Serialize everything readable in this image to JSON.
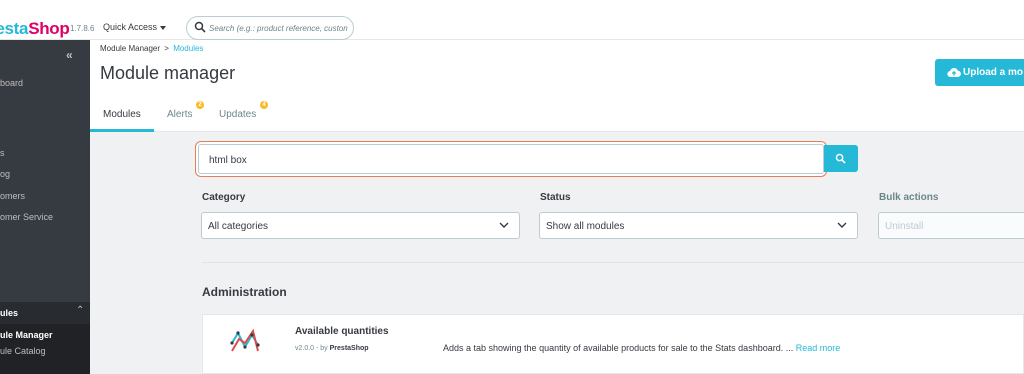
{
  "header": {
    "logo_presta": "Presta",
    "logo_shop": "Shop",
    "version": "1.7.8.6",
    "quick_access": "Quick Access",
    "search_placeholder": "Search (e.g.: product reference, custon"
  },
  "sidebar": {
    "items": [
      {
        "label": "board"
      },
      {
        "label": "s"
      },
      {
        "label": "og"
      },
      {
        "label": "omers"
      },
      {
        "label": "omer Service"
      }
    ],
    "active_section": "ules",
    "sub_items": [
      {
        "label": "ule Manager"
      },
      {
        "label": "ule Catalog"
      }
    ]
  },
  "page": {
    "breadcrumb_parent": "Module Manager",
    "breadcrumb_sep": ">",
    "breadcrumb_current": "Modules",
    "title": "Module manager",
    "upload_label": "Upload a mo"
  },
  "tabs": [
    {
      "label": "Modules",
      "badge": ""
    },
    {
      "label": "Alerts",
      "badge": "2"
    },
    {
      "label": "Updates",
      "badge": "4"
    }
  ],
  "search": {
    "value": "html box"
  },
  "filters": {
    "category_label": "Category",
    "category_value": "All categories",
    "status_label": "Status",
    "status_value": "Show all modules",
    "bulk_label": "Bulk actions",
    "bulk_value": "Uninstall"
  },
  "section": {
    "title": "Administration"
  },
  "module": {
    "name": "Available quantities",
    "version": "v2.0.0 - by",
    "author": "PrestaShop",
    "description": "Adds a tab showing the quantity of available products for sale to the Stats dashboard. ...",
    "read_more": "Read more"
  },
  "colors": {
    "accent": "#25b9d7",
    "brand_pink": "#df0067",
    "sidebar_bg": "#363a41",
    "badge": "#fbbb22",
    "focus_ring": "#e67e54"
  }
}
